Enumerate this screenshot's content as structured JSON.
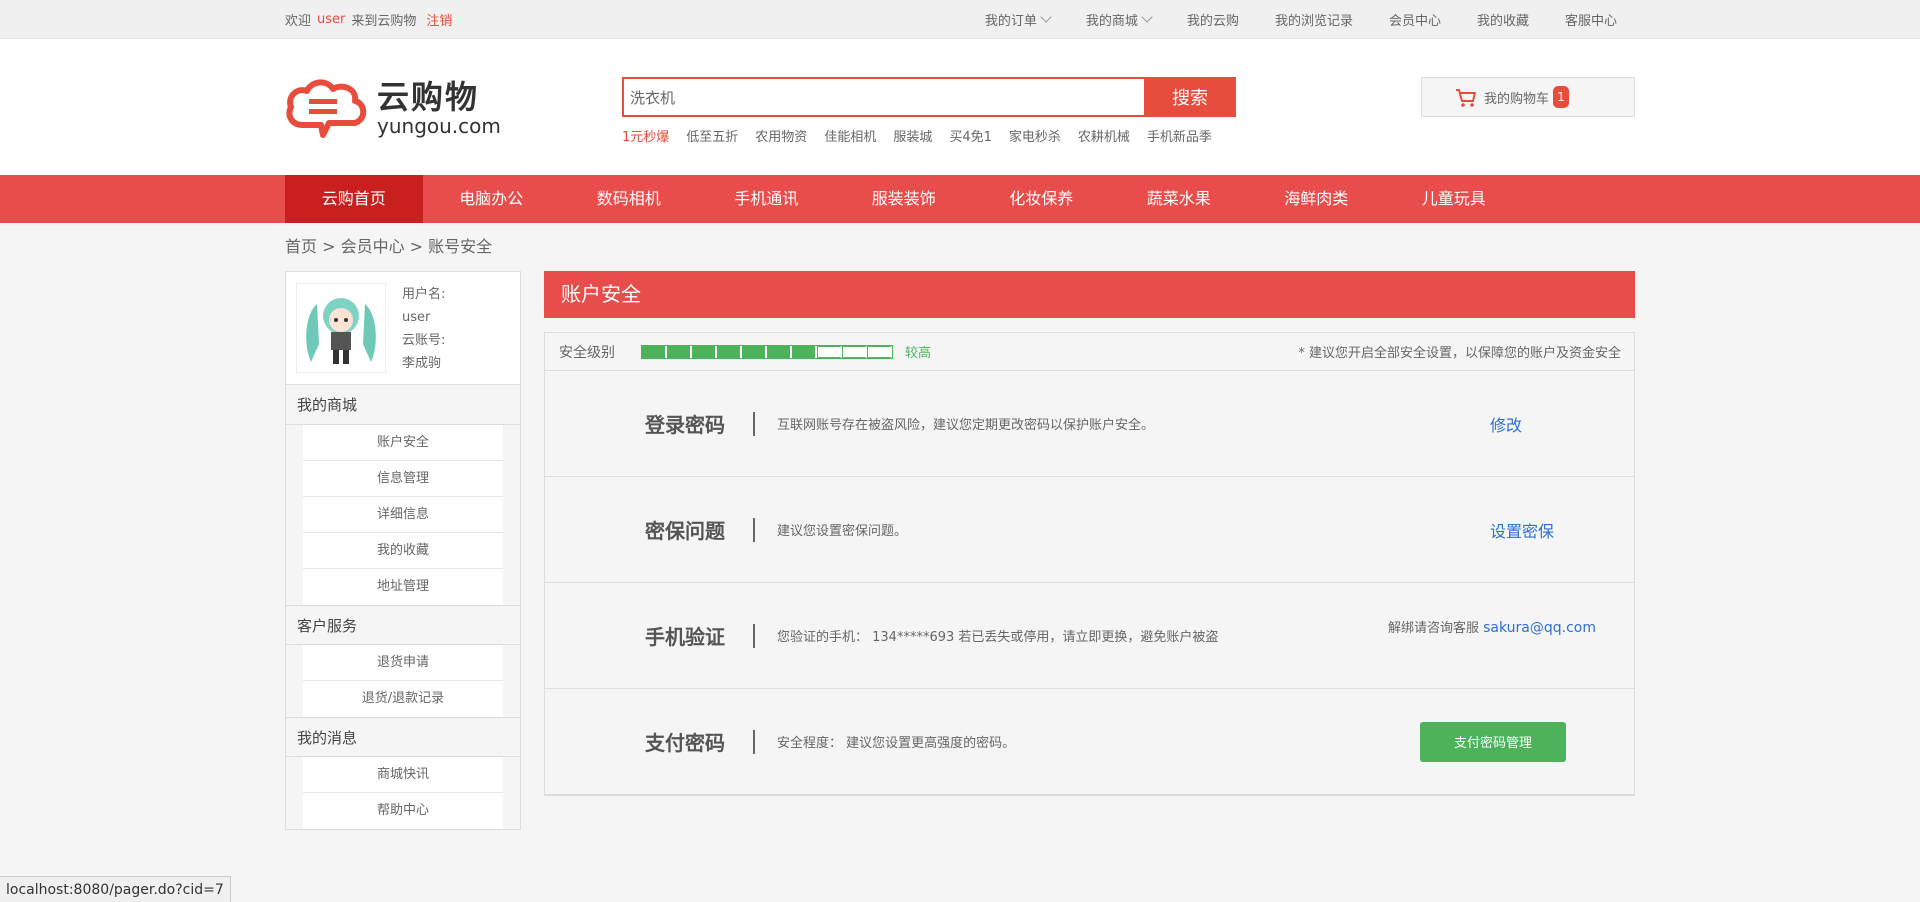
{
  "topbar": {
    "welcome": "欢迎",
    "username": "user",
    "welcome_suffix": "来到云购物",
    "logout": "注销",
    "links": [
      "我的订单",
      "我的商城",
      "我的云购",
      "我的浏览记录",
      "会员中心",
      "我的收藏",
      "客服中心"
    ]
  },
  "header": {
    "logo_cn": "云购物",
    "logo_en": "yungou.com",
    "search_value": "洗衣机",
    "search_button": "搜索",
    "hotwords": [
      "1元秒爆",
      "低至五折",
      "农用物资",
      "佳能相机",
      "服装城",
      "买4免1",
      "家电秒杀",
      "农耕机械",
      "手机新品季"
    ],
    "cart_label": "我的购物车",
    "cart_count": "1"
  },
  "nav": [
    "云购首页",
    "电脑办公",
    "数码相机",
    "手机通讯",
    "服装装饰",
    "化妆保养",
    "蔬菜水果",
    "海鲜肉类",
    "儿童玩具"
  ],
  "breadcrumb": "首页 > 会员中心 > 账号安全",
  "sidebar": {
    "profile": {
      "username_label": "用户名:",
      "username": "user",
      "account_label": "云账号:",
      "account": "李成驹"
    },
    "groups": [
      {
        "title": "我的商城",
        "items": [
          "账户安全",
          "信息管理",
          "详细信息",
          "我的收藏",
          "地址管理"
        ]
      },
      {
        "title": "客户服务",
        "items": [
          "退货申请",
          "退货/退款记录"
        ]
      },
      {
        "title": "我的消息",
        "items": [
          "商城快讯",
          "帮助中心"
        ]
      }
    ]
  },
  "main": {
    "title": "账户安全",
    "level_label": "安全级别",
    "level_filled": 7,
    "level_total": 10,
    "level_text": "较高",
    "level_tip": "* 建议您开启全部安全设置，以保障您的账户及资金安全",
    "rows": [
      {
        "name": "登录密码",
        "desc": "互联网账号存在被盗风险，建议您定期更改密码以保护账户安全。",
        "action": "修改"
      },
      {
        "name": "密保问题",
        "desc": "建议您设置密保问题。",
        "action": "设置密保"
      },
      {
        "name": "手机验证",
        "desc": "您验证的手机： 134*****693 若已丢失或停用，请立即更换，避免账户被盗",
        "action_prefix": "解绑请咨询客服",
        "action": "sakura@qq.com"
      },
      {
        "name": "支付密码",
        "desc": "安全程度： 建议您设置更高强度的密码。",
        "action": "支付密码管理"
      }
    ]
  },
  "status_url": "localhost:8080/pager.do?cid=7",
  "colors": {
    "accent": "#e84c4b",
    "nav_active": "#c9201f",
    "green": "#4db35a",
    "link": "#2e6fd3"
  }
}
